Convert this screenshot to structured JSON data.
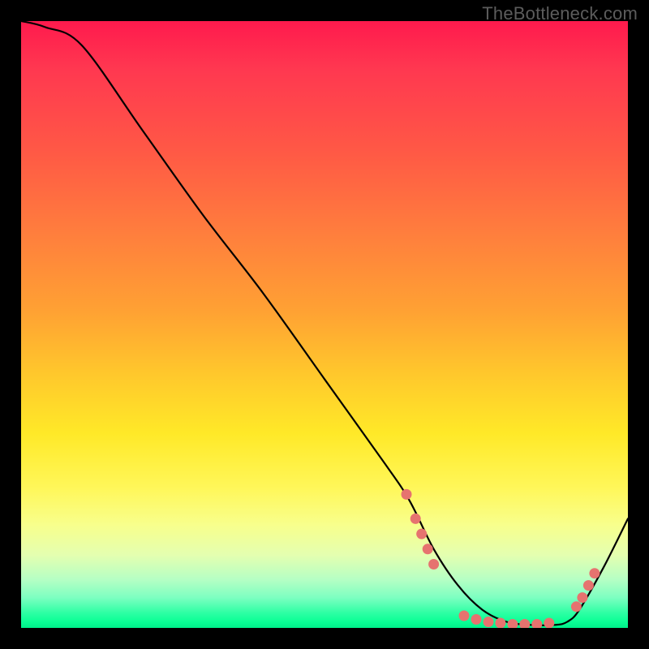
{
  "attribution": "TheBottleneck.com",
  "chart_data": {
    "type": "line",
    "title": "",
    "xlabel": "",
    "ylabel": "",
    "xlim": [
      0,
      100
    ],
    "ylim": [
      0,
      100
    ],
    "series": [
      {
        "name": "curve",
        "x": [
          0,
          4,
          10,
          20,
          30,
          40,
          50,
          60,
          64,
          68,
          72,
          76,
          80,
          84,
          88,
          90,
          92,
          96,
          100
        ],
        "y": [
          100,
          99,
          96,
          82,
          68,
          55,
          41,
          27,
          21,
          13,
          7,
          3,
          1,
          0.5,
          0.5,
          1,
          3,
          10,
          18
        ]
      }
    ],
    "markers": [
      {
        "x": 63.5,
        "y": 22.0
      },
      {
        "x": 65.0,
        "y": 18.0
      },
      {
        "x": 66.0,
        "y": 15.5
      },
      {
        "x": 67.0,
        "y": 13.0
      },
      {
        "x": 68.0,
        "y": 10.5
      },
      {
        "x": 73.0,
        "y": 2.0
      },
      {
        "x": 75.0,
        "y": 1.4
      },
      {
        "x": 77.0,
        "y": 1.0
      },
      {
        "x": 79.0,
        "y": 0.8
      },
      {
        "x": 81.0,
        "y": 0.6
      },
      {
        "x": 83.0,
        "y": 0.6
      },
      {
        "x": 85.0,
        "y": 0.6
      },
      {
        "x": 87.0,
        "y": 0.8
      },
      {
        "x": 91.5,
        "y": 3.5
      },
      {
        "x": 92.5,
        "y": 5.0
      },
      {
        "x": 93.5,
        "y": 7.0
      },
      {
        "x": 94.5,
        "y": 9.0
      }
    ],
    "gradient_colors": {
      "top": "#ff1a4d",
      "mid": "#ffe928",
      "bottom": "#00f08a"
    },
    "marker_color": "#e6736f",
    "line_color": "#000000"
  }
}
